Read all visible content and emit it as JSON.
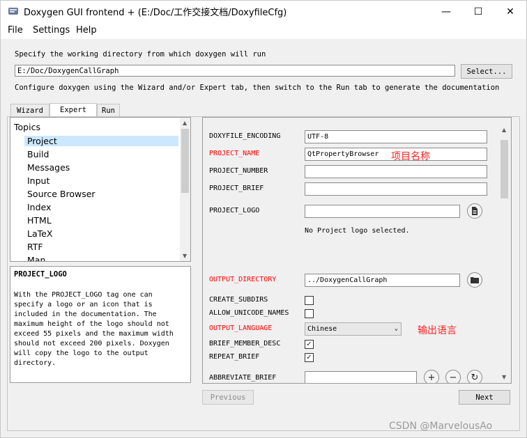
{
  "window": {
    "title": "Doxygen GUI frontend + (E:/Doc/工作交接文档/DoxyfileCfg)",
    "minimize": "—",
    "maximize": "☐",
    "close": "✕"
  },
  "menu": [
    "File",
    "Settings",
    "Help"
  ],
  "workdir": {
    "label": "Specify the working directory from which doxygen will run",
    "value": "E:/Doc/DoxygenCallGraph",
    "select_label": "Select...",
    "hint": "Configure doxygen using the Wizard and/or Expert tab, then switch to the Run tab to generate the documentation"
  },
  "tabs": [
    "Wizard",
    "Expert",
    "Run"
  ],
  "active_tab": "Expert",
  "topics": {
    "title": "Topics",
    "items": [
      "Project",
      "Build",
      "Messages",
      "Input",
      "Source Browser",
      "Index",
      "HTML",
      "LaTeX",
      "RTF",
      "Man"
    ],
    "selected": "Project"
  },
  "help": {
    "title": "PROJECT_LOGO",
    "text": "With the PROJECT_LOGO tag one can\nspecify a logo or an icon that is\nincluded in the documentation. The\nmaximum height of the logo should not\nexceed 55 pixels and the maximum width\nshould not exceed 200 pixels. Doxygen\nwill copy the logo to the output\ndirectory."
  },
  "fields": {
    "doxyfile_encoding": {
      "label": "DOXYFILE_ENCODING",
      "value": "UTF-8"
    },
    "project_name": {
      "label": "PROJECT_NAME",
      "value": "QtPropertyBrowser"
    },
    "project_number": {
      "label": "PROJECT_NUMBER",
      "value": ""
    },
    "project_brief": {
      "label": "PROJECT_BRIEF",
      "value": ""
    },
    "project_logo": {
      "label": "PROJECT_LOGO",
      "value": "",
      "status": "No Project logo selected."
    },
    "output_directory": {
      "label": "OUTPUT_DIRECTORY",
      "value": "../DoxygenCallGraph"
    },
    "create_subdirs": {
      "label": "CREATE_SUBDIRS",
      "checked": false
    },
    "allow_unicode_names": {
      "label": "ALLOW_UNICODE_NAMES",
      "checked": false
    },
    "output_language": {
      "label": "OUTPUT_LANGUAGE",
      "value": "Chinese"
    },
    "brief_member_desc": {
      "label": "BRIEF_MEMBER_DESC",
      "checked": true
    },
    "repeat_brief": {
      "label": "REPEAT_BRIEF",
      "checked": true
    },
    "abbreviate_brief": {
      "label": "ABBREVIATE_BRIEF",
      "value": ""
    }
  },
  "annotations": {
    "project_name": "项目名称",
    "output_language": "输出语言"
  },
  "nav": {
    "previous": "Previous",
    "next": "Next"
  },
  "watermark": "CSDN @MarvelousAo",
  "colors": {
    "highlight_label": "#ff0000",
    "selection": "#cce8ff",
    "annotation": "#ff2020"
  }
}
